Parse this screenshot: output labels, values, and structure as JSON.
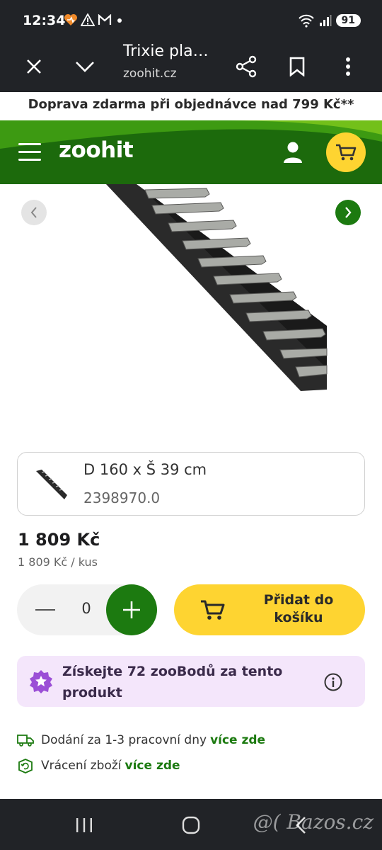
{
  "status_bar": {
    "time": "12:34",
    "battery": "91"
  },
  "browser": {
    "title": "Trixie pla…",
    "url": "zoohit.cz"
  },
  "promo": {
    "text": "Doprava zdarma při objednávce nad 799 Kč**"
  },
  "header": {
    "logo": "zoohit"
  },
  "variant": {
    "size": "D 160 x Š 39 cm",
    "code": "2398970.0"
  },
  "price": {
    "main": "1 809 Kč",
    "unit": "1 809 Kč / kus"
  },
  "quantity": {
    "value": "0"
  },
  "cart": {
    "add_label_line1": "Přidat do",
    "add_label_line2": "košíku"
  },
  "points": {
    "text": "Získejte 72 zooBodů za tento produkt"
  },
  "info": {
    "delivery_text": "Dodání za 1-3 pracovní dny",
    "delivery_link": "více zde",
    "return_text": "Vrácení zboží",
    "return_link": "více zde"
  },
  "watermark": {
    "text": "@( Bazos.cz"
  },
  "colors": {
    "brand_green": "#1c7a10",
    "header_green": "#1c6a0c",
    "accent_yellow": "#fed431",
    "points_bg": "#f4e6fb",
    "points_purple": "#9b4fd6"
  }
}
